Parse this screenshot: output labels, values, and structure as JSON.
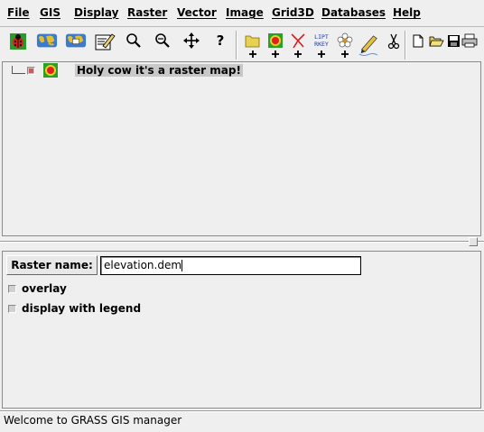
{
  "menu": [
    "File",
    "GIS",
    "Display",
    "Raster",
    "Vector",
    "Image",
    "Grid3D",
    "Databases",
    "Help"
  ],
  "toolbar": {
    "tools": [
      "start-monitor",
      "display-active-layers",
      "display-all-layers",
      "erase-display",
      "zoom-in",
      "zoom-out",
      "pan",
      "query"
    ],
    "layers": [
      "add-group",
      "add-raster",
      "add-vector",
      "add-legend-text",
      "add-other-commands",
      "add-labels",
      "remove-layer"
    ],
    "files": [
      "new-file",
      "open-file",
      "save-file",
      "print"
    ],
    "legend_icon_text": [
      "LIPT",
      "RKEY"
    ]
  },
  "tree": {
    "layer_label": "Holy cow it's a raster map!"
  },
  "options": {
    "raster_name_label": "Raster name:",
    "raster_name_value": "elevation.dem",
    "overlay_label": "overlay",
    "legend_label": "display with legend"
  },
  "status": {
    "message": "Welcome to GRASS GIS manager"
  },
  "colors": {
    "background": "#efefef",
    "selection": "#c8c8c8"
  }
}
